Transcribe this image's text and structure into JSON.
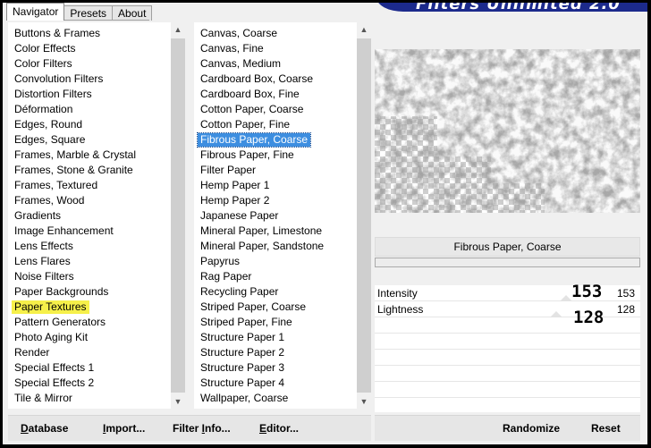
{
  "tabs": [
    "Navigator",
    "Presets",
    "About"
  ],
  "banner_title": "Filters Unlimited 2.0",
  "categories": [
    "Buttons & Frames",
    "Color Effects",
    "Color Filters",
    "Convolution Filters",
    "Distortion Filters",
    "Déformation",
    "Edges, Round",
    "Edges, Square",
    "Frames, Marble & Crystal",
    "Frames, Stone & Granite",
    "Frames, Textured",
    "Frames, Wood",
    "Gradients",
    "Image Enhancement",
    "Lens Effects",
    "Lens Flares",
    "Noise Filters",
    "Paper Backgrounds",
    "Paper Textures",
    "Pattern Generators",
    "Photo Aging Kit",
    "Render",
    "Special Effects 1",
    "Special Effects 2",
    "Tile & Mirror"
  ],
  "selected_category": "Paper Textures",
  "filters": [
    "Canvas, Coarse",
    "Canvas, Fine",
    "Canvas, Medium",
    "Cardboard Box, Coarse",
    "Cardboard Box, Fine",
    "Cotton Paper, Coarse",
    "Cotton Paper, Fine",
    "Fibrous Paper, Coarse",
    "Fibrous Paper, Fine",
    "Filter Paper",
    "Hemp Paper 1",
    "Hemp Paper 2",
    "Japanese Paper",
    "Mineral Paper, Limestone",
    "Mineral Paper, Sandstone",
    "Papyrus",
    "Rag Paper",
    "Recycling Paper",
    "Striped Paper, Coarse",
    "Striped Paper, Fine",
    "Structure Paper 1",
    "Structure Paper 2",
    "Structure Paper 3",
    "Structure Paper 4",
    "Wallpaper, Coarse"
  ],
  "selected_filter": "Fibrous Paper, Coarse",
  "filter_name": "Fibrous Paper, Coarse",
  "params": [
    {
      "label": "Intensity",
      "value": "153",
      "overlay": "153",
      "fraction": 0.6
    },
    {
      "label": "Lightness",
      "value": "128",
      "overlay": "128",
      "fraction": 0.5
    }
  ],
  "buttons_left": [
    {
      "pre": "",
      "key": "D",
      "post": "atabase"
    },
    {
      "pre": "",
      "key": "I",
      "post": "mport..."
    },
    {
      "pre": "Filter ",
      "key": "I",
      "post": "nfo..."
    },
    {
      "pre": "",
      "key": "E",
      "post": "ditor..."
    }
  ],
  "buttons_right": [
    {
      "label": "Randomize"
    },
    {
      "label": "Reset"
    }
  ],
  "colors": {
    "selection": "#3d8ee0",
    "highlight": "#f6f04a",
    "banner": "#1c2a8c"
  }
}
